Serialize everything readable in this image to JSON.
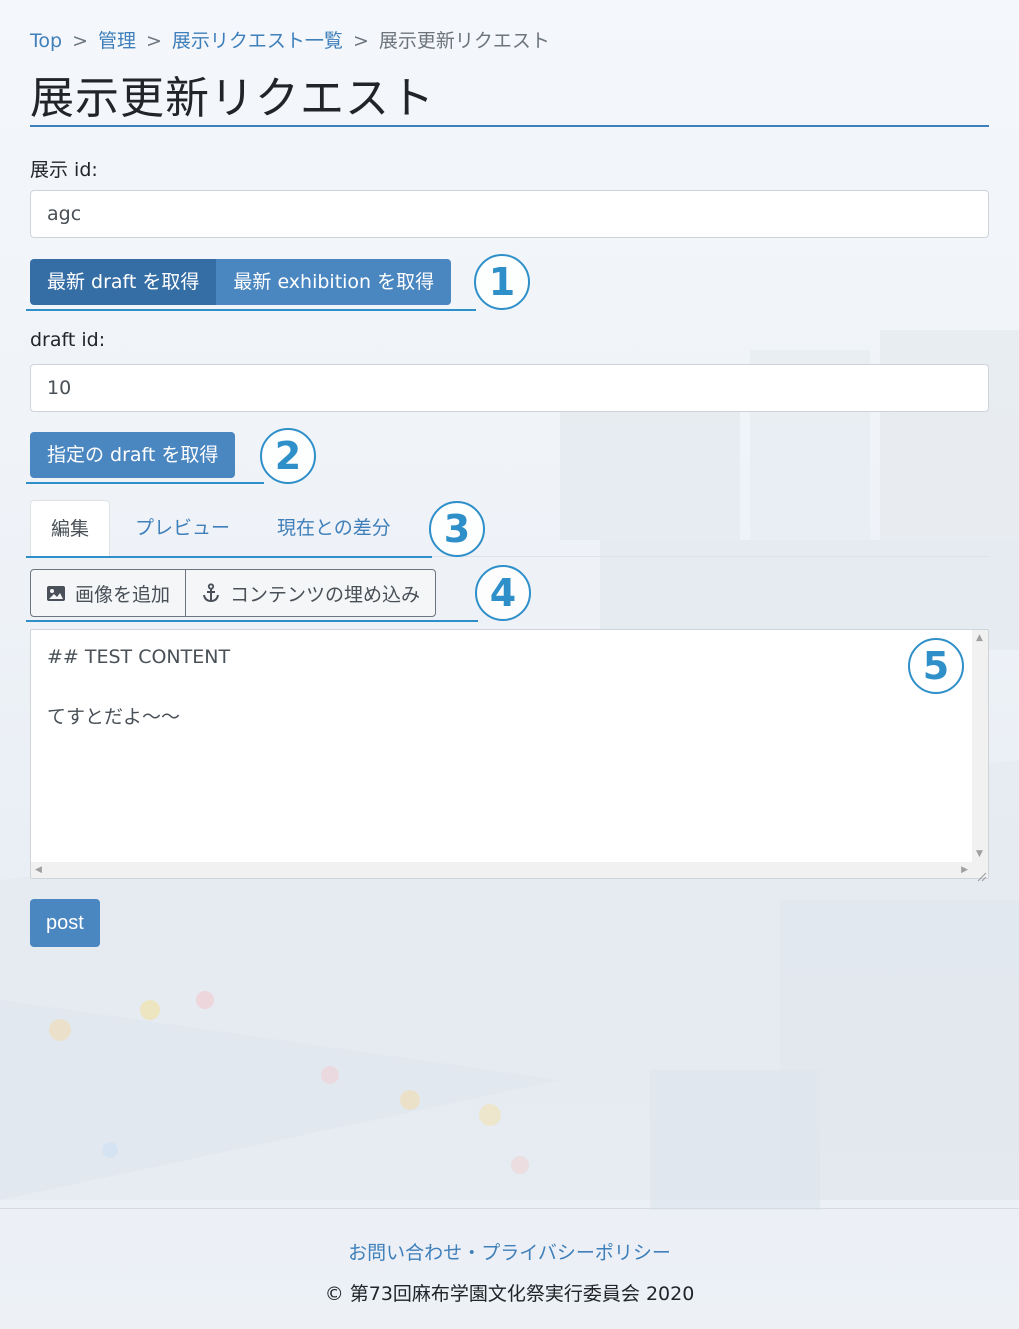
{
  "breadcrumb": {
    "items": [
      "Top",
      "管理",
      "展示リクエスト一覧"
    ],
    "separator": ">",
    "current": "展示更新リクエスト"
  },
  "page_title": "展示更新リクエスト",
  "exhibit_id": {
    "label": "展示 id:",
    "value": "agc"
  },
  "fetch_buttons": {
    "latest_draft": "最新 draft を取得",
    "latest_exhibition": "最新 exhibition を取得"
  },
  "draft_id": {
    "label": "draft id:",
    "value": "10"
  },
  "fetch_specific_draft": "指定の draft を取得",
  "tabs": [
    {
      "label": "編集",
      "active": true
    },
    {
      "label": "プレビュー",
      "active": false
    },
    {
      "label": "現在との差分",
      "active": false
    }
  ],
  "toolbar": {
    "add_image": "画像を追加",
    "embed_content": "コンテンツの埋め込み"
  },
  "editor": {
    "lines": [
      "## TEST CONTENT",
      "",
      "てすとだよ〜〜"
    ]
  },
  "post_button": "post",
  "callouts": [
    "1",
    "2",
    "3",
    "4",
    "5"
  ],
  "footer": {
    "contact": "お問い合わせ",
    "separator": "・",
    "privacy": "プライバシーポリシー",
    "copyright": "© 第73回麻布学園文化祭実行委員会 2020"
  },
  "colors": {
    "accent": "#3f7fba",
    "button": "#4a86c0",
    "button_active": "#356ea5",
    "callout": "#2e8fc9"
  }
}
